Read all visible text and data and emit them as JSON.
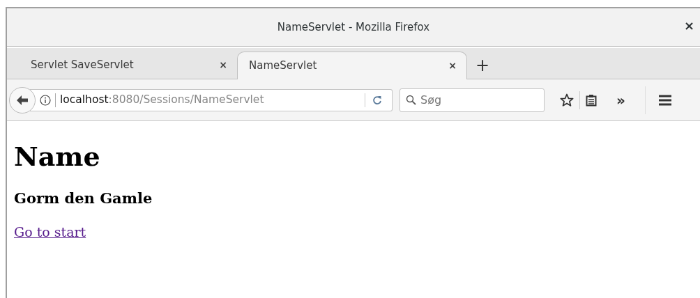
{
  "window": {
    "title": "NameServlet - Mozilla Firefox",
    "close": "×"
  },
  "tabs": [
    {
      "label": "Servlet SaveServlet",
      "close": "×",
      "selected": false
    },
    {
      "label": "NameServlet",
      "close": "×",
      "selected": true
    }
  ],
  "new_tab": "+",
  "url": {
    "host": "localhost",
    "path": ":8080/Sessions/NameServlet"
  },
  "search": {
    "placeholder": "Søg"
  },
  "overflow": "»",
  "page": {
    "heading": "Name",
    "subheading": "Gorm den Gamle",
    "link": "Go to start"
  }
}
